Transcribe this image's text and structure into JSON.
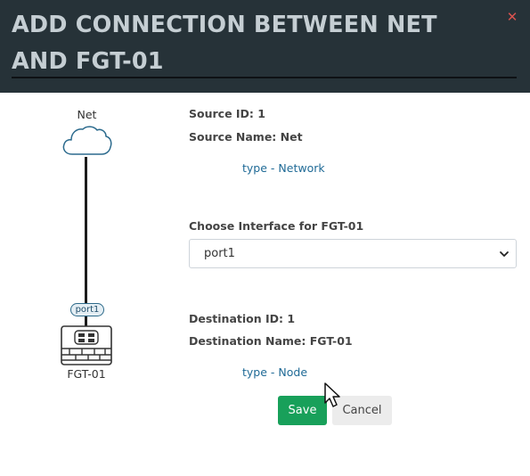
{
  "dialog": {
    "title": "ADD CONNECTION BETWEEN NET AND FGT-01",
    "close_icon": "close-icon"
  },
  "diagram": {
    "source_label": "Net",
    "source_icon": "cloud-icon",
    "port_label": "port1",
    "destination_label": "FGT-01",
    "destination_icon": "firewall-icon"
  },
  "source": {
    "id_text": "Source ID: 1",
    "name_text": "Source Name: Net",
    "type_prefix": "type",
    "type_sep": " - ",
    "type_value": "Network"
  },
  "interface": {
    "label": "Choose Interface for FGT-01",
    "selected": "port1"
  },
  "destination": {
    "id_text": "Destination ID: 1",
    "name_text": "Destination Name: FGT-01",
    "type_prefix": "type",
    "type_sep": " - ",
    "type_value": "Node"
  },
  "buttons": {
    "save": "Save",
    "cancel": "Cancel"
  },
  "colors": {
    "header_bg": "#263238",
    "title_text": "#c5ced3",
    "close": "#d9534f",
    "link": "#1f6a96",
    "save_bg": "#18a05a",
    "cancel_bg": "#ececec"
  }
}
